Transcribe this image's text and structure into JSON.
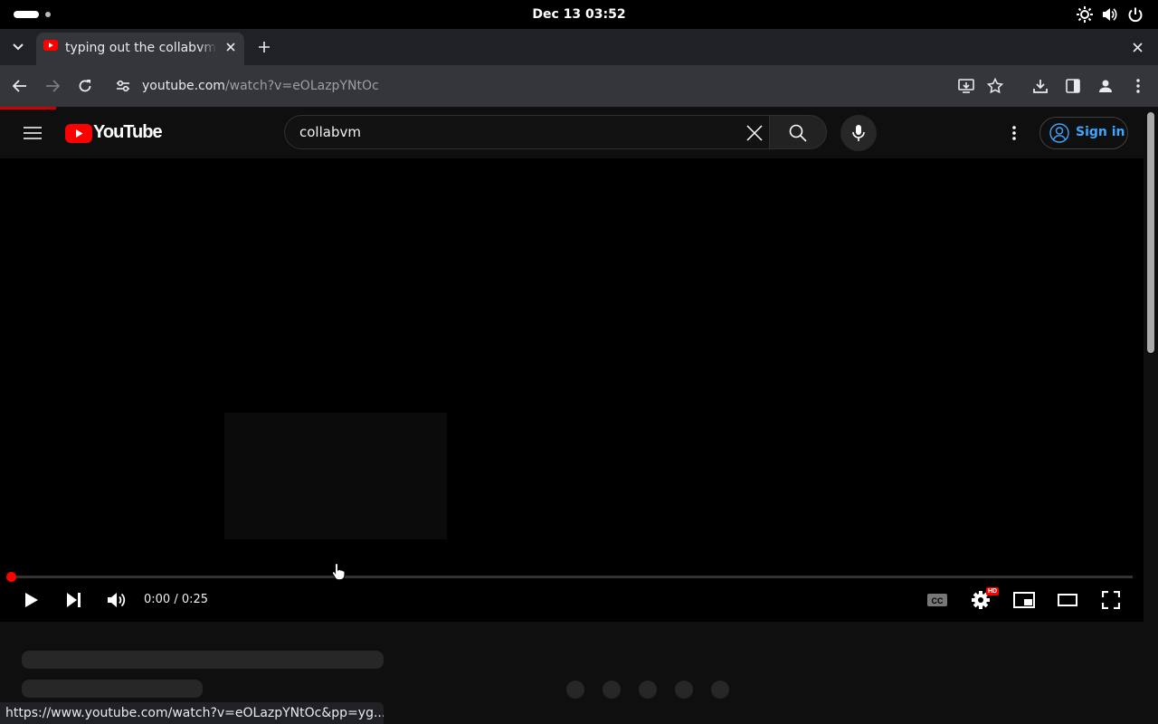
{
  "system": {
    "clock": "Dec 13  03:52",
    "icons": [
      "brightness-icon",
      "volume-icon",
      "power-icon"
    ]
  },
  "browser": {
    "tab": {
      "title": "typing out the collabvm n",
      "favicon": "youtube-favicon-icon"
    },
    "url_host": "youtube.com",
    "url_path": "/watch?v=eOLazpYNtOc",
    "status_url": "https://www.youtube.com/watch?v=eOLazpYNtOc&pp=yg..."
  },
  "youtube": {
    "logo_text": "YouTube",
    "search_value": "collabvm",
    "signin_label": "Sign in",
    "player": {
      "time": "0:00 / 0:25",
      "progress_fraction": 0.0,
      "hd_badge": "HD"
    }
  },
  "colors": {
    "brand_red": "#ff0000",
    "link_blue": "#3ea6ff",
    "chrome_dark": "#202124",
    "chrome_toolbar": "#35363a"
  }
}
